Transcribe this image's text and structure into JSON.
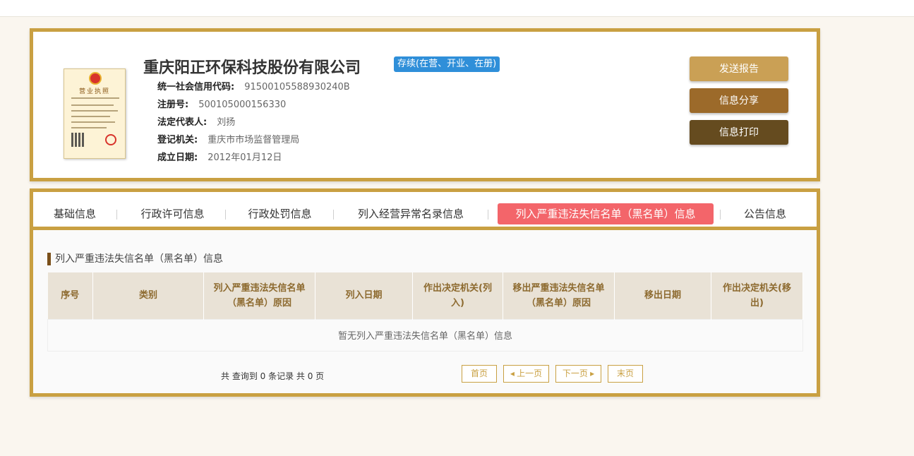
{
  "header": {
    "license_title": "营业执照",
    "company_name": "重庆阳正环保科技股份有限公司",
    "status": "存续(在营、开业、在册)",
    "fields": [
      {
        "label": "统一社会信用代码:",
        "value": "91500105588930240B"
      },
      {
        "label": "注册号:",
        "value": "500105000156330"
      },
      {
        "label": "法定代表人:",
        "value": "刘扬"
      },
      {
        "label": "登记机关:",
        "value": "重庆市市场监督管理局"
      },
      {
        "label": "成立日期:",
        "value": "2012年01月12日"
      }
    ],
    "buttons": {
      "send": "发送报告",
      "share": "信息分享",
      "print": "信息打印"
    }
  },
  "tabs": [
    {
      "label": "基础信息"
    },
    {
      "label": "行政许可信息"
    },
    {
      "label": "行政处罚信息"
    },
    {
      "label": "列入经营异常名录信息"
    },
    {
      "label": "列入严重违法失信名单（黑名单）信息"
    },
    {
      "label": "公告信息"
    }
  ],
  "section": {
    "title": "列入严重违法失信名单（黑名单）信息",
    "columns": [
      "序号",
      "类别",
      "列入严重违法失信名单（黑名单）原因",
      "列入日期",
      "作出决定机关(列入)",
      "移出严重违法失信名单（黑名单）原因",
      "移出日期",
      "作出决定机关(移出)"
    ],
    "empty_text": "暂无列入严重违法失信名单（黑名单）信息"
  },
  "pagination": {
    "total_text": "共 查询到 0 条记录 共 0 页",
    "first": "首页",
    "prev": "◂ 上一页",
    "next": "下一页 ▸",
    "last": "末页"
  },
  "colors": {
    "gold": "#c9a042",
    "status_badge": "#2f8fd9",
    "active_tab": "#f3656a",
    "send_button": "#caa055",
    "share_button": "#9c6a2a",
    "print_button": "#654b1f"
  }
}
